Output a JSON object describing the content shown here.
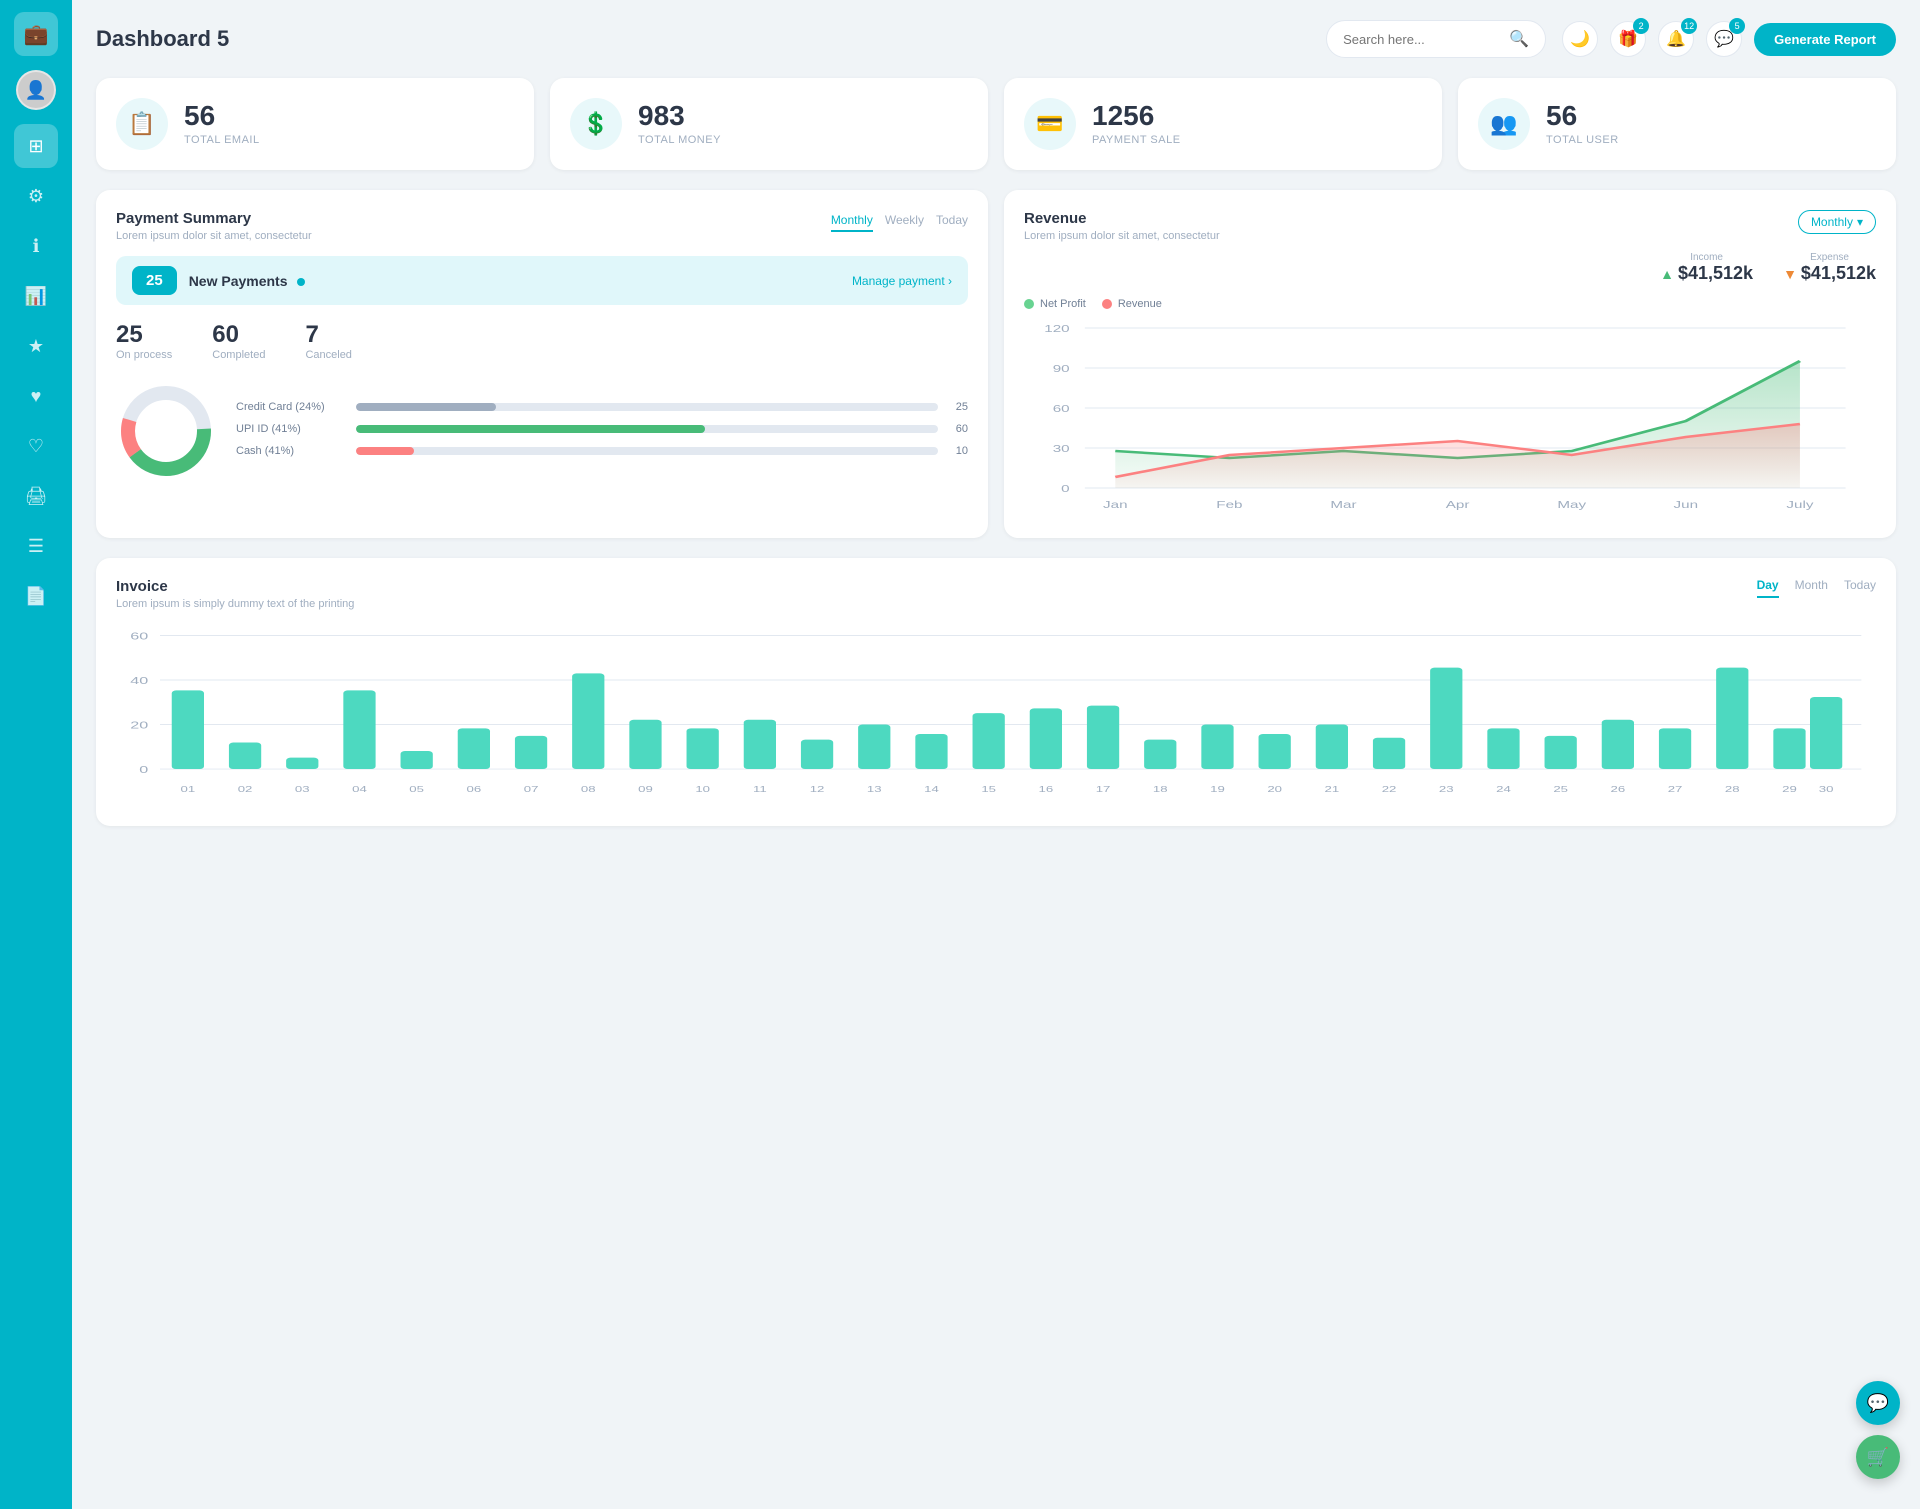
{
  "app": {
    "title": "Dashboard 5"
  },
  "header": {
    "search_placeholder": "Search here...",
    "generate_btn": "Generate Report",
    "icon_gift_badge": "2",
    "icon_bell_badge": "12",
    "icon_chat_badge": "5"
  },
  "stats": [
    {
      "id": "total-email",
      "icon": "📋",
      "number": "56",
      "label": "TOTAL EMAIL"
    },
    {
      "id": "total-money",
      "icon": "💲",
      "number": "983",
      "label": "TOTAL MONEY"
    },
    {
      "id": "payment-sale",
      "icon": "💳",
      "number": "1256",
      "label": "PAYMENT SALE"
    },
    {
      "id": "total-user",
      "icon": "👥",
      "number": "56",
      "label": "TOTAL USER"
    }
  ],
  "payment_summary": {
    "title": "Payment Summary",
    "subtitle": "Lorem ipsum dolor sit amet, consectetur",
    "tabs": [
      "Monthly",
      "Weekly",
      "Today"
    ],
    "active_tab": "Monthly",
    "new_payments_count": "25",
    "new_payments_label": "New Payments",
    "manage_link": "Manage payment",
    "stats": [
      {
        "num": "25",
        "label": "On process"
      },
      {
        "num": "60",
        "label": "Completed"
      },
      {
        "num": "7",
        "label": "Canceled"
      }
    ],
    "progress_bars": [
      {
        "label": "Credit Card (24%)",
        "percent": 24,
        "color": "#a0aec0",
        "value": "25"
      },
      {
        "label": "UPI ID (41%)",
        "percent": 41,
        "color": "#48bb78",
        "value": "60"
      },
      {
        "label": "Cash (41%)",
        "percent": 10,
        "color": "#fc8181",
        "value": "10"
      }
    ]
  },
  "revenue": {
    "title": "Revenue",
    "subtitle": "Lorem ipsum dolor sit amet, consectetur",
    "dropdown_label": "Monthly",
    "income": {
      "label": "Income",
      "amount": "$41,512k",
      "icon": "▲"
    },
    "expense": {
      "label": "Expense",
      "amount": "$41,512k",
      "icon": "▼"
    },
    "legend": [
      {
        "label": "Net Profit",
        "color": "#68d391"
      },
      {
        "label": "Revenue",
        "color": "#fc8181"
      }
    ],
    "x_labels": [
      "Jan",
      "Feb",
      "Mar",
      "Apr",
      "May",
      "Jun",
      "July"
    ],
    "y_labels": [
      "0",
      "30",
      "60",
      "90",
      "120"
    ],
    "net_profit_points": [
      28,
      22,
      28,
      22,
      28,
      50,
      95
    ],
    "revenue_points": [
      8,
      25,
      30,
      35,
      25,
      38,
      48
    ]
  },
  "invoice": {
    "title": "Invoice",
    "subtitle": "Lorem ipsum is simply dummy text of the printing",
    "tabs": [
      "Day",
      "Month",
      "Today"
    ],
    "active_tab": "Day",
    "y_labels": [
      "0",
      "20",
      "40",
      "60"
    ],
    "x_labels": [
      "01",
      "02",
      "03",
      "04",
      "05",
      "06",
      "07",
      "08",
      "09",
      "10",
      "11",
      "12",
      "13",
      "14",
      "15",
      "16",
      "17",
      "18",
      "19",
      "20",
      "21",
      "22",
      "23",
      "24",
      "25",
      "26",
      "27",
      "28",
      "29",
      "30"
    ],
    "bar_values": [
      35,
      12,
      5,
      35,
      8,
      18,
      15,
      43,
      22,
      18,
      22,
      13,
      20,
      16,
      25,
      27,
      28,
      13,
      20,
      16,
      20,
      14,
      45,
      18,
      15,
      22,
      18,
      45,
      18,
      32
    ]
  },
  "sidebar": {
    "items": [
      {
        "icon": "⊞",
        "label": "dashboard",
        "active": true
      },
      {
        "icon": "⚙",
        "label": "settings"
      },
      {
        "icon": "ℹ",
        "label": "info"
      },
      {
        "icon": "📊",
        "label": "analytics"
      },
      {
        "icon": "★",
        "label": "favorites"
      },
      {
        "icon": "♥",
        "label": "likes"
      },
      {
        "icon": "♡",
        "label": "wishlist"
      },
      {
        "icon": "🖨",
        "label": "print"
      },
      {
        "icon": "☰",
        "label": "menu"
      },
      {
        "icon": "📄",
        "label": "reports"
      }
    ]
  },
  "floating": {
    "btn1": "💬",
    "btn2": "🛒"
  }
}
